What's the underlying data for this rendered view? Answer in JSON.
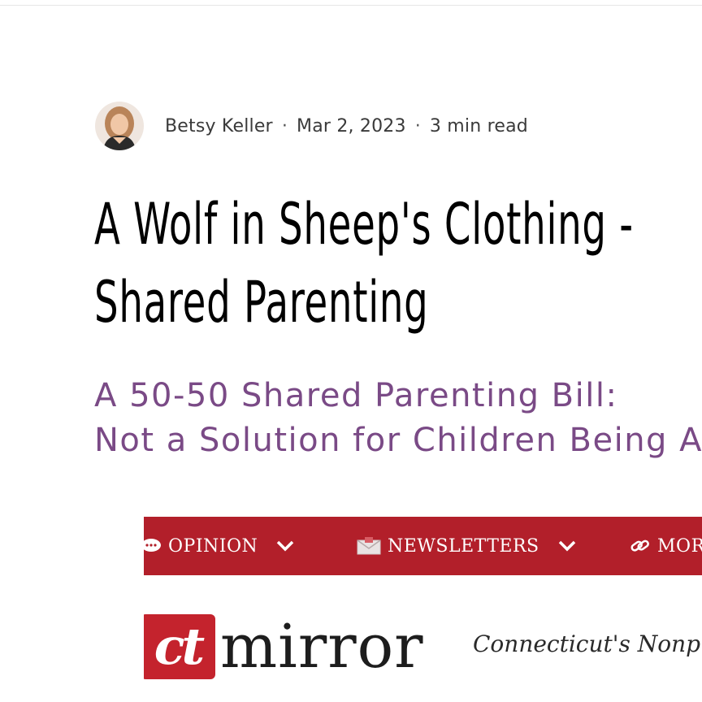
{
  "author": {
    "name": "Betsy Keller",
    "date": "Mar 2, 2023",
    "read_time": "3 min read",
    "separator": "·"
  },
  "headline": {
    "line1": "A Wolf in Sheep's Clothing -",
    "line2": "Shared Parenting"
  },
  "subtitle": {
    "line1": "A 50-50 Shared Parenting Bill:",
    "line2": "Not a Solution for Children Being A"
  },
  "embedded_image": {
    "nav": {
      "items": [
        "OPINION",
        "NEWSLETTERS",
        "MOR"
      ]
    },
    "logo": {
      "mark": "ct",
      "word": "mirror"
    },
    "tagline": "Connecticut's Nonprof",
    "colors": {
      "nav_background": "#b21f2a",
      "logo_red": "#c4232d"
    }
  },
  "colors": {
    "headline": "#000000",
    "subtitle": "#7a4a86",
    "meta": "#3a3a3a"
  }
}
